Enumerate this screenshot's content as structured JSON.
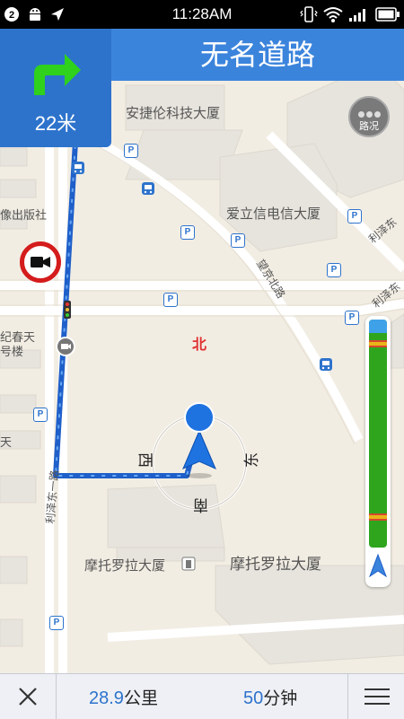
{
  "status_bar": {
    "notification_count": "2",
    "time": "11:28AM",
    "icons": [
      "android-icon",
      "location-arrow-icon",
      "vibrate-icon",
      "wifi-icon",
      "signal-icon",
      "battery-icon"
    ]
  },
  "navigation": {
    "turn_direction": "turn-right",
    "distance": "22米",
    "road_name": "无名道路"
  },
  "traffic_button": {
    "label": "路况"
  },
  "map": {
    "labels": {
      "anjelun": "安捷伦科技大厦",
      "aixinxin": "爱立信电信大厦",
      "chubanshe": "像出版社",
      "chuntian": "纪春天",
      "haolou": "号楼",
      "tian": "天",
      "wangjing_bei": "望京北路",
      "lize_dong_top": "利泽东",
      "lize_dong_mid": "利泽东",
      "lize_dong_road": "利泽东一路",
      "motorola_small": "摩托罗拉大厦",
      "motorola_big": "摩托罗拉大厦"
    },
    "compass": {
      "north": "北",
      "south": "南",
      "east": "东",
      "west": "西"
    },
    "parking_label": "P"
  },
  "route_progress": {
    "completed_fraction": 0.06,
    "jam_fraction_positions": [
      0.09,
      0.85
    ]
  },
  "bottom_bar": {
    "distance_value": "28.9",
    "distance_unit": "公里",
    "time_value": "50",
    "time_unit": "分钟"
  },
  "colors": {
    "header_blue": "#3b84dc",
    "turn_arrow_green": "#2fd11c",
    "route_blue": "#2d73cc",
    "traffic_green": "#2fa51e",
    "camera_red": "#d41c1c"
  }
}
